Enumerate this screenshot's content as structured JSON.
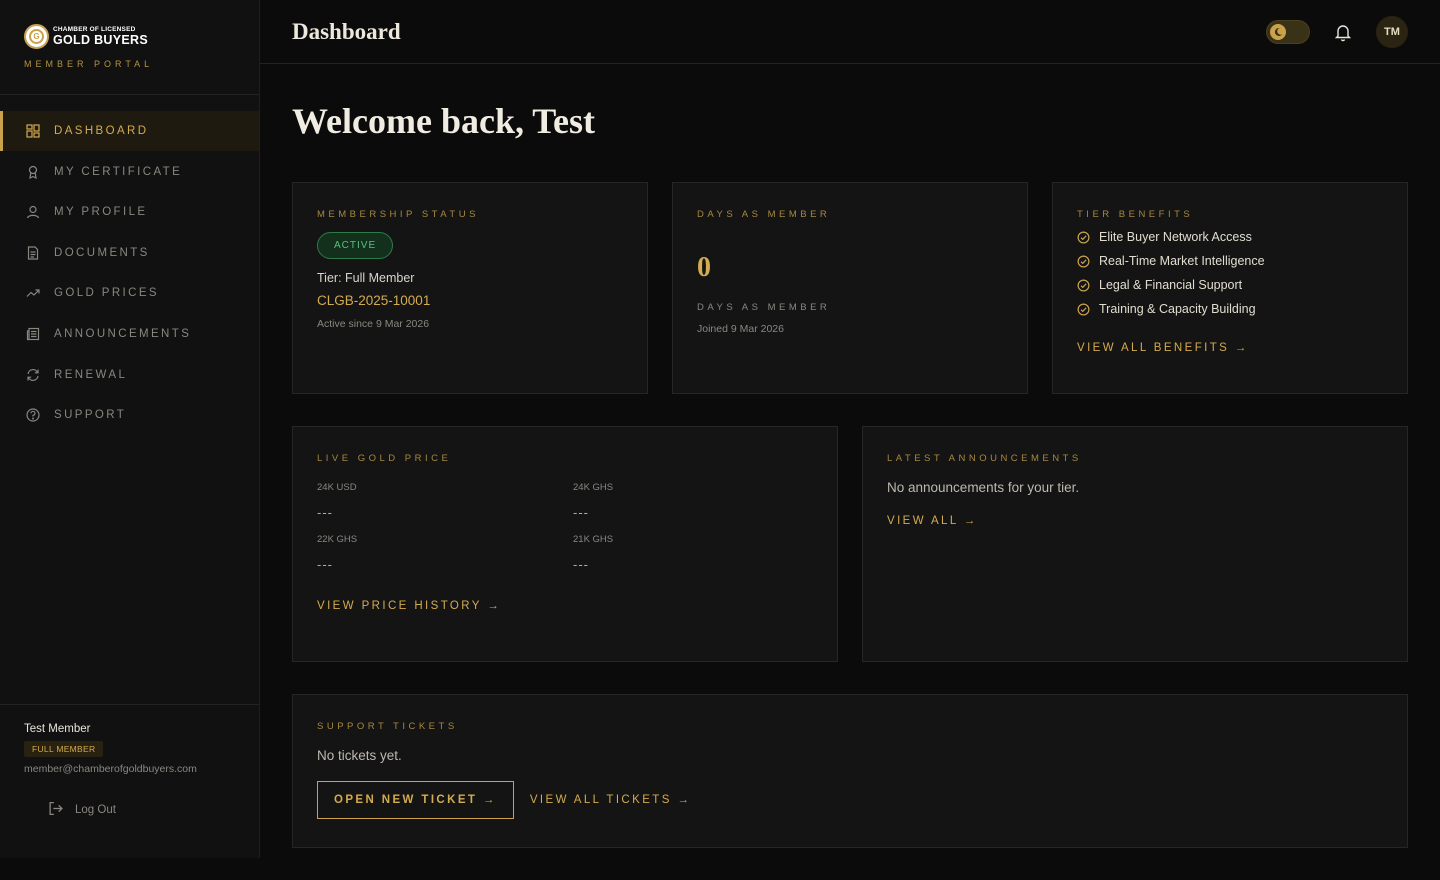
{
  "brand": {
    "logo_line1": "CHAMBER OF LICENSED",
    "logo_line2": "GOLD BUYERS",
    "portal": "MEMBER PORTAL"
  },
  "sidebar": {
    "items": [
      {
        "label": "DASHBOARD",
        "icon": "grid-icon",
        "active": true
      },
      {
        "label": "MY CERTIFICATE",
        "icon": "award-icon"
      },
      {
        "label": "MY PROFILE",
        "icon": "user-icon"
      },
      {
        "label": "DOCUMENTS",
        "icon": "document-icon"
      },
      {
        "label": "GOLD PRICES",
        "icon": "trending-up-icon"
      },
      {
        "label": "ANNOUNCEMENTS",
        "icon": "newspaper-icon"
      },
      {
        "label": "RENEWAL",
        "icon": "refresh-icon"
      },
      {
        "label": "SUPPORT",
        "icon": "help-circle-icon"
      }
    ],
    "user": {
      "name": "Test Member",
      "tier": "FULL MEMBER",
      "email": "member@chamberofgoldbuyers.com"
    },
    "logout": "Log Out"
  },
  "header": {
    "title": "Dashboard",
    "avatar_initials": "TM"
  },
  "main": {
    "welcome": "Welcome back, Test",
    "membership": {
      "label": "MEMBERSHIP STATUS",
      "status": "ACTIVE",
      "tier": "Tier: Full Member",
      "member_id": "CLGB-2025-10001",
      "since": "Active since 9 Mar 2026"
    },
    "days": {
      "label": "DAYS AS MEMBER",
      "value": "0",
      "sub": "DAYS AS MEMBER",
      "joined": "Joined 9 Mar 2026"
    },
    "benefits": {
      "label": "TIER BENEFITS",
      "items": [
        "Elite Buyer Network Access",
        "Real-Time Market Intelligence",
        "Legal & Financial Support",
        "Training & Capacity Building"
      ],
      "link": "VIEW ALL BENEFITS →"
    },
    "gold": {
      "label": "LIVE GOLD PRICE",
      "prices": [
        {
          "label": "24K USD",
          "value": "---"
        },
        {
          "label": "24K GHS",
          "value": "---"
        },
        {
          "label": "22K GHS",
          "value": "---"
        },
        {
          "label": "21K GHS",
          "value": "---"
        }
      ],
      "link": "VIEW PRICE HISTORY →"
    },
    "announcements": {
      "label": "LATEST ANNOUNCEMENTS",
      "empty": "No announcements for your tier.",
      "link": "VIEW ALL →"
    },
    "tickets": {
      "label": "SUPPORT TICKETS",
      "empty": "No tickets yet.",
      "open_button": "OPEN NEW TICKET →",
      "view_link": "VIEW ALL TICKETS →"
    }
  },
  "colors": {
    "accent": "#caa24c",
    "background": "#0b0b0b",
    "card": "#141414",
    "status_green": "#56c27c"
  }
}
